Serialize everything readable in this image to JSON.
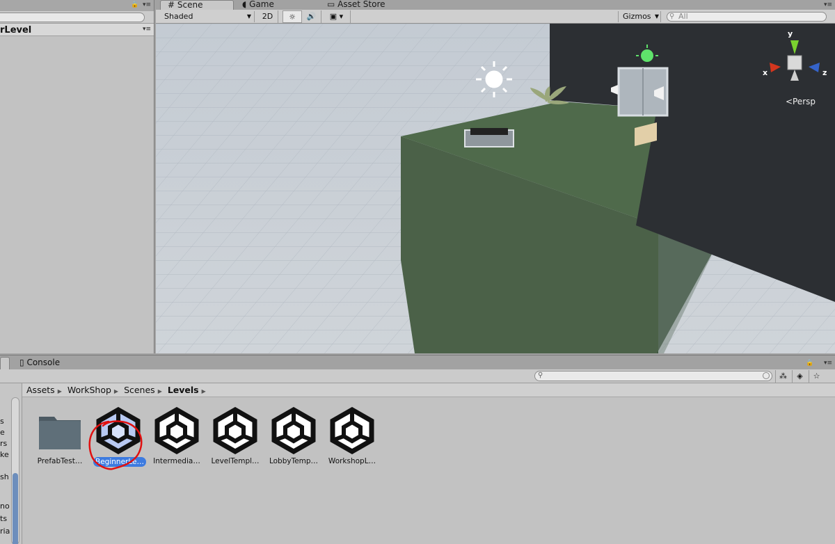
{
  "hierarchy": {
    "title": "rLevel"
  },
  "scene": {
    "tabs": [
      "Scene",
      "Game",
      "Asset Store"
    ],
    "draw_mode": "Shaded",
    "mode_2d": "2D",
    "gizmos": "Gizmos",
    "search_placeholder": "All",
    "projection_label": "Persp",
    "axis_labels": {
      "x": "x",
      "y": "y",
      "z": "z"
    }
  },
  "bottom": {
    "console_tab": "Console",
    "breadcrumb": [
      "Assets",
      "WorkShop",
      "Scenes",
      "Levels"
    ],
    "left_fragments": [
      "s",
      "e",
      "rs",
      "ke",
      "sh",
      "no",
      "ts",
      "ria"
    ],
    "assets": [
      {
        "label": "PrefabTest…",
        "icon": "folder-icon",
        "selected": false
      },
      {
        "label": "BeginnerLe…",
        "icon": "unity-scene-icon",
        "selected": true
      },
      {
        "label": "Intermedia…",
        "icon": "unity-scene-icon",
        "selected": false
      },
      {
        "label": "LevelTempl…",
        "icon": "unity-scene-icon",
        "selected": false
      },
      {
        "label": "LobbyTemp…",
        "icon": "unity-scene-icon",
        "selected": false
      },
      {
        "label": "WorkshopL…",
        "icon": "unity-scene-icon",
        "selected": false
      }
    ]
  },
  "colors": {
    "selection": "#3d7be0",
    "platform": "#4c6649",
    "wall": "#2c2f33",
    "annotation": "#e01010"
  }
}
